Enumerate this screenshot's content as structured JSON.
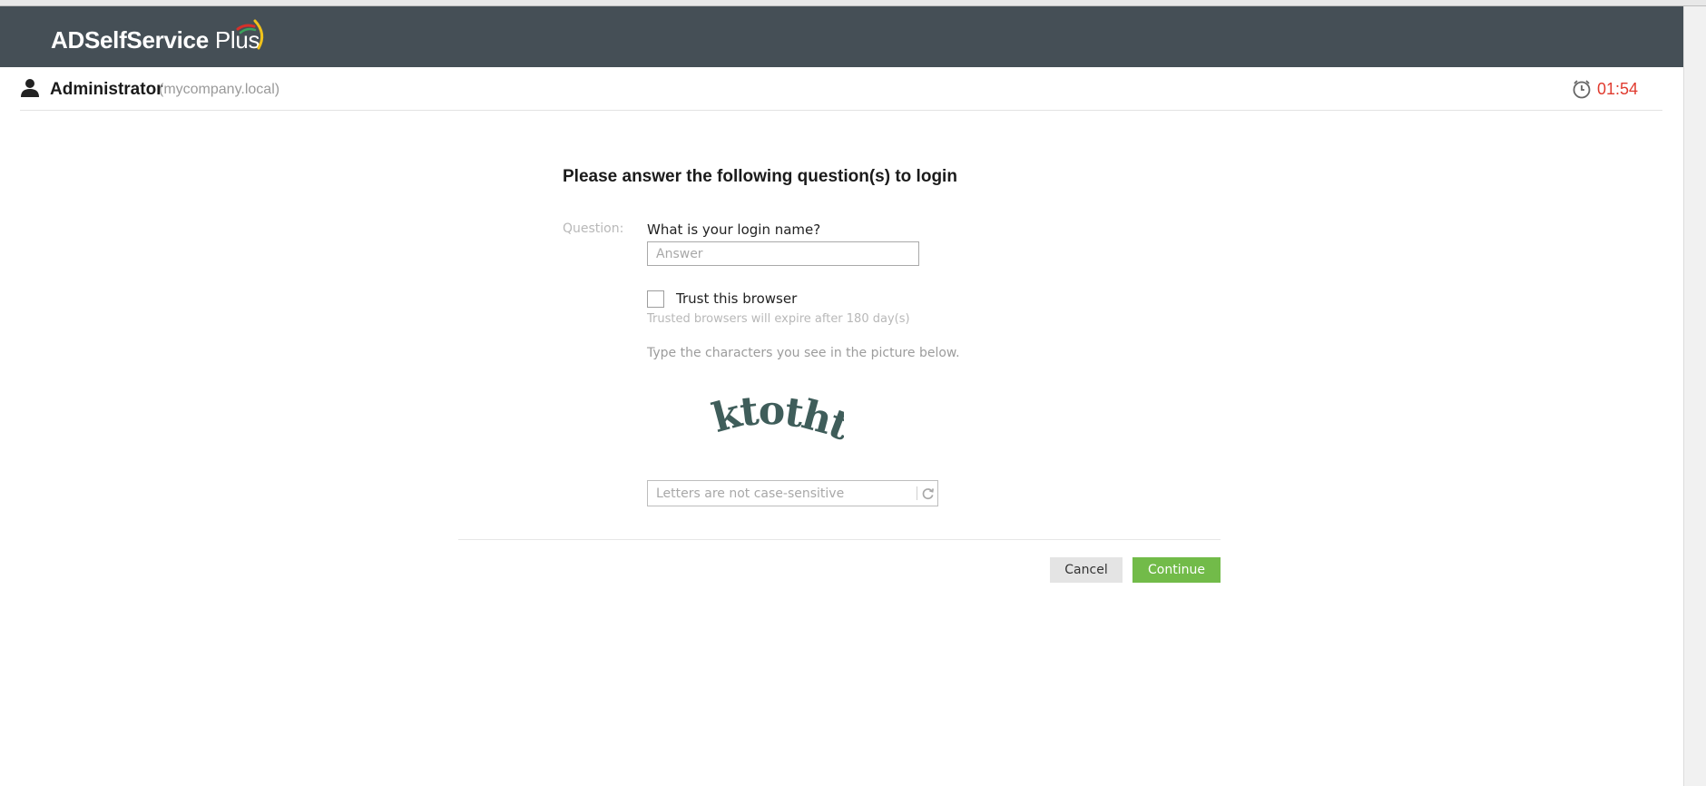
{
  "header": {
    "brand": "ADSelfService",
    "brand_suffix": "Plus"
  },
  "user": {
    "name": "Administrator",
    "domain": "(mycompany.local)",
    "icon": "user-icon"
  },
  "timer": {
    "value": "01:54",
    "icon": "clock-icon",
    "color": "#e03a2e"
  },
  "form": {
    "heading": "Please answer the following question(s) to login",
    "question_label": "Question:",
    "question_text": "What is your login name?",
    "answer_placeholder": "Answer",
    "trust_label": "Trust this browser",
    "trust_checked": false,
    "trust_note": "Trusted browsers will expire after 180 day(s)",
    "captcha_hint": "Type the characters you see in the picture below.",
    "captcha_text": "ktotht",
    "captcha_placeholder": "Letters are not case-sensitive"
  },
  "buttons": {
    "cancel": "Cancel",
    "continue": "Continue"
  },
  "colors": {
    "header_bg": "#454f56",
    "accent_green": "#72bb49",
    "timer_red": "#e03a2e"
  }
}
